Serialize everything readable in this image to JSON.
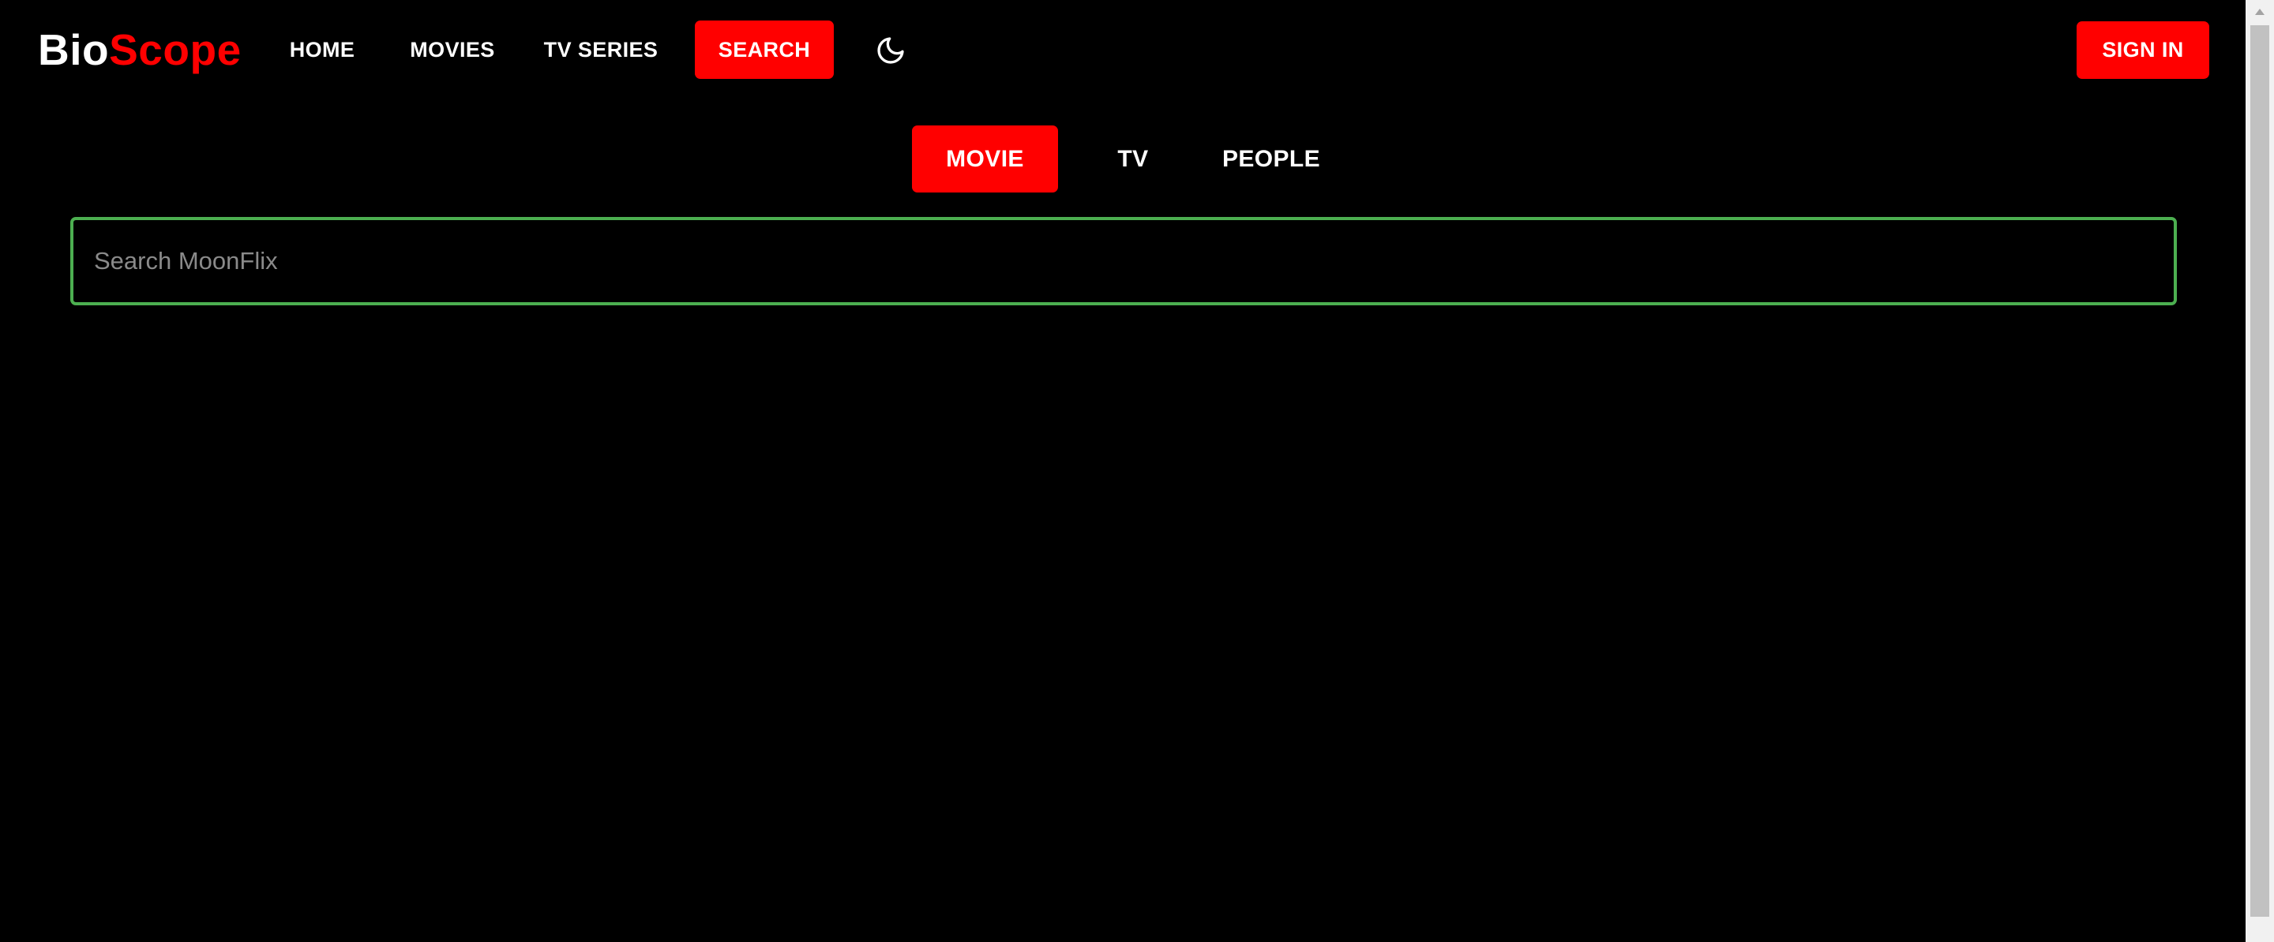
{
  "brand": {
    "part1": "Bio",
    "part2": "Scope",
    "color_primary": "#ffffff",
    "color_accent": "#ff0000"
  },
  "nav": {
    "home": "HOME",
    "movies": "MOVIES",
    "tv_series": "TV SERIES",
    "search": "SEARCH",
    "active": "SEARCH"
  },
  "theme_toggle": {
    "icon": "moon-icon"
  },
  "auth": {
    "sign_in": "SIGN IN"
  },
  "tabs": {
    "items": [
      {
        "label": "MOVIE",
        "active": true
      },
      {
        "label": "TV",
        "active": false
      },
      {
        "label": "PEOPLE",
        "active": false
      }
    ]
  },
  "search": {
    "placeholder": "Search MoonFlix",
    "value": "",
    "border_color": "#4caf50"
  },
  "theme": {
    "background": "#000000",
    "accent": "#ff0000",
    "text": "#ffffff"
  }
}
